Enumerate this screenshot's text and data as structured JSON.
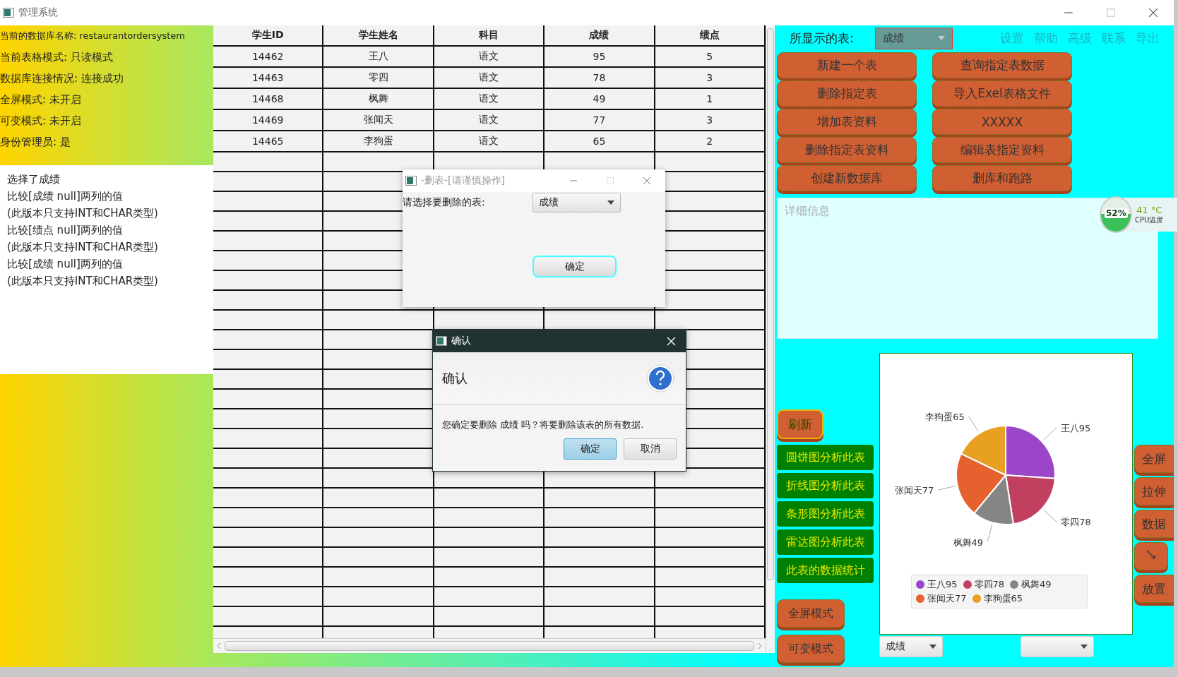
{
  "window": {
    "title": "管理系统"
  },
  "status_panel": {
    "lines": [
      "当前的数据库名称: restaurantordersystem",
      "当前表格模式: 只读模式",
      "数据库连接情况: 连接成功",
      "全屏模式: 未开启",
      "可变模式: 未开启",
      "身份管理员: 是"
    ]
  },
  "log_panel": {
    "lines": [
      "选择了成绩",
      "比较[成绩 null]两列的值",
      "(此版本只支持INT和CHAR类型)",
      "比较[绩点 null]两列的值",
      "(此版本只支持INT和CHAR类型)",
      "比较[成绩 null]两列的值",
      "(此版本只支持INT和CHAR类型)"
    ]
  },
  "table": {
    "columns": [
      "学生ID",
      "学生姓名",
      "科目",
      "成绩",
      "绩点"
    ],
    "rows": [
      [
        "14462",
        "王八",
        "语文",
        "95",
        "5"
      ],
      [
        "14463",
        "零四",
        "语文",
        "78",
        "3"
      ],
      [
        "14468",
        "枫舞",
        "语文",
        "49",
        "1"
      ],
      [
        "14469",
        "张闻天",
        "语文",
        "77",
        "3"
      ],
      [
        "14465",
        "李狗蛋",
        "语文",
        "65",
        "2"
      ]
    ]
  },
  "toolbar": {
    "table_label": "所显示的表:",
    "table_select": "成绩",
    "links": [
      "设置",
      "帮助",
      "高级",
      "联系",
      "导出"
    ]
  },
  "action_buttons": [
    "新建一个表",
    "查询指定表数据",
    "删除指定表",
    "导入Exel表格文件",
    "增加表资料",
    "XXXXX",
    "删除指定表资料",
    "编辑表指定资料",
    "创建新数据库",
    "删库和跑路"
  ],
  "details": {
    "placeholder": "详细信息"
  },
  "cpu_widget": {
    "level": 0.52,
    "percent": "52%",
    "temperature": "41 °C",
    "label": "CPU温度"
  },
  "refresh_button": "刷新",
  "chart_buttons": [
    "圆饼图分析此表",
    "折线图分析此表",
    "条形图分析此表",
    "雷达图分析此表",
    "此表的数据统计"
  ],
  "mode_buttons": [
    "全屏模式",
    "可变模式"
  ],
  "chart": {
    "chart_data": {
      "type": "pie",
      "categories": [
        "王八95",
        "零四78",
        "枫舞49",
        "张闻天77",
        "李狗蛋65"
      ],
      "values": [
        95,
        78,
        49,
        77,
        65
      ],
      "legend": "bottom"
    }
  },
  "chart_select": "成绩",
  "side_buttons": [
    {
      "kind": "text",
      "label": "全屏"
    },
    {
      "kind": "text",
      "label": "拉伸"
    },
    {
      "kind": "text",
      "label": "数据"
    },
    {
      "kind": "arrow"
    },
    {
      "kind": "text",
      "label": "放置"
    }
  ],
  "delete_dialog": {
    "title": "-删表-[请谨慎操作]",
    "active": false,
    "prompt": "请选择要删除的表:",
    "select": "成绩",
    "button": "确定"
  },
  "confirm_dialog": {
    "title": "确认",
    "active": true,
    "header": "确认",
    "message": "您确定要删除 成绩 吗？将要删除该表的所有数据.",
    "buttons": [
      {
        "label": "确定",
        "default": true
      },
      {
        "label": "取消",
        "default": false
      }
    ]
  }
}
